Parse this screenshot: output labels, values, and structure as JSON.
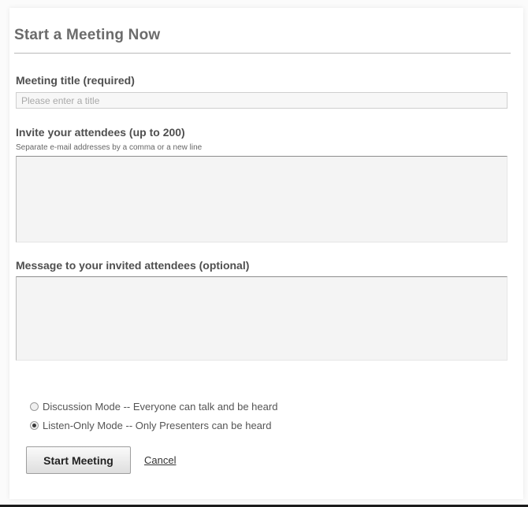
{
  "form": {
    "heading": "Start a Meeting Now",
    "title_label": "Meeting title (required)",
    "title_placeholder": "Please enter a title",
    "title_value": "",
    "attendees_label": "Invite your attendees (up to 200)",
    "attendees_hint": "Separate e-mail addresses by a comma or a new line",
    "attendees_value": "",
    "message_label": "Message to your invited attendees (optional)",
    "message_value": "",
    "modes": [
      {
        "label": "Discussion Mode -- Everyone can talk and be heard",
        "selected": false
      },
      {
        "label": "Listen-Only Mode -- Only Presenters can be heard",
        "selected": true
      }
    ],
    "start_button_label": "Start Meeting",
    "cancel_label": "Cancel"
  }
}
